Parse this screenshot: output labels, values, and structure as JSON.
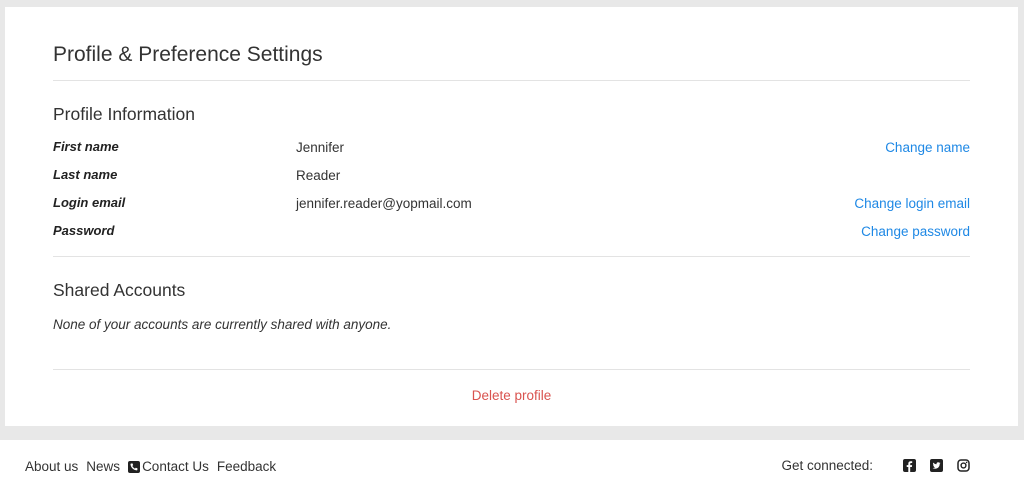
{
  "page": {
    "title": "Profile & Preference Settings"
  },
  "profile": {
    "section_title": "Profile Information",
    "rows": [
      {
        "label": "First name",
        "value": "Jennifer",
        "action": "Change name"
      },
      {
        "label": "Last name",
        "value": "Reader",
        "action": ""
      },
      {
        "label": "Login email",
        "value": "jennifer.reader@yopmail.com",
        "action": "Change login email"
      },
      {
        "label": "Password",
        "value": "",
        "action": "Change password"
      }
    ]
  },
  "shared": {
    "section_title": "Shared Accounts",
    "note": "None of your accounts are currently shared with anyone."
  },
  "delete_label": "Delete profile",
  "footer": {
    "links": {
      "about": "About us",
      "news": "News",
      "contact": "Contact Us",
      "feedback": "Feedback"
    },
    "social_label": "Get connected:",
    "social_icons": [
      "facebook-icon",
      "twitter-icon",
      "instagram-icon"
    ]
  },
  "colors": {
    "link": "#1e88e5",
    "danger": "#d9534f",
    "background": "#e8e8e8"
  }
}
